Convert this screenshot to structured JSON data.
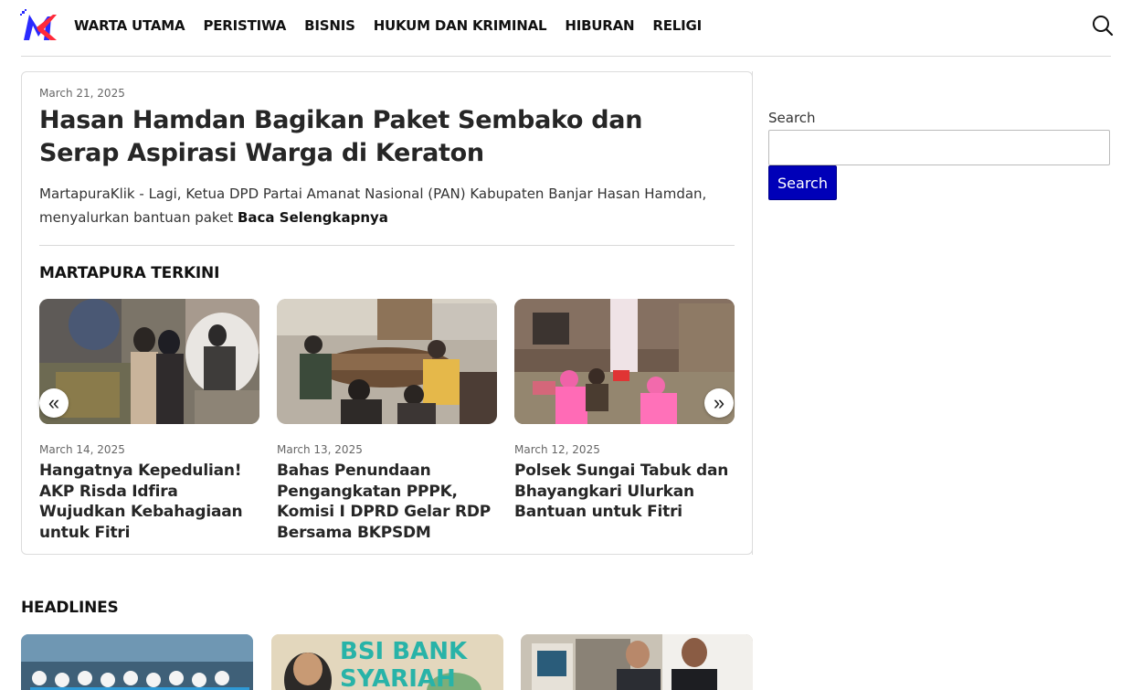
{
  "header": {
    "logo_text": "MK",
    "nav": [
      "WARTA UTAMA",
      "PERISTIWA",
      "BISNIS",
      "HUKUM DAN KRIMINAL",
      "HIBURAN",
      "RELIGI"
    ],
    "search_icon": "search-icon"
  },
  "featured": {
    "date": "March 21, 2025",
    "title": "Hasan Hamdan Bagikan Paket Sembako dan Serap Aspirasi Warga di Keraton",
    "excerpt": "MartapuraKlik - Lagi, Ketua DPD Partai Amanat Nasional (PAN) Kabupaten Banjar Hasan Hamdan, menyalurkan bantuan paket",
    "read_more": "Baca Selengkapnya"
  },
  "terkini": {
    "title": "MARTAPURA TERKINI",
    "prev": "«",
    "next": "»",
    "items": [
      {
        "date": "March 14, 2025",
        "title": "Hangatnya Kepedulian! AKP Risda Idfira Wujudkan Kebahagiaan untuk Fitri"
      },
      {
        "date": "March 13, 2025",
        "title": "Bahas Penundaan Pengangkatan PPPK, Komisi I DPRD Gelar RDP Bersama BKPSDM"
      },
      {
        "date": "March 12, 2025",
        "title": "Polsek Sungai Tabuk dan Bhayangkari Ulurkan Bantuan untuk Fitri"
      }
    ]
  },
  "sidebar": {
    "search_label": "Search",
    "search_placeholder": "",
    "search_button": "Search"
  },
  "headlines": {
    "title": "HEADLINES",
    "image_text": "BSI BANK SYARIAH INDONESIA"
  },
  "colors": {
    "accent": "#0000b8",
    "logo_blue": "#2a2aff",
    "logo_red": "#ff2a3a"
  }
}
